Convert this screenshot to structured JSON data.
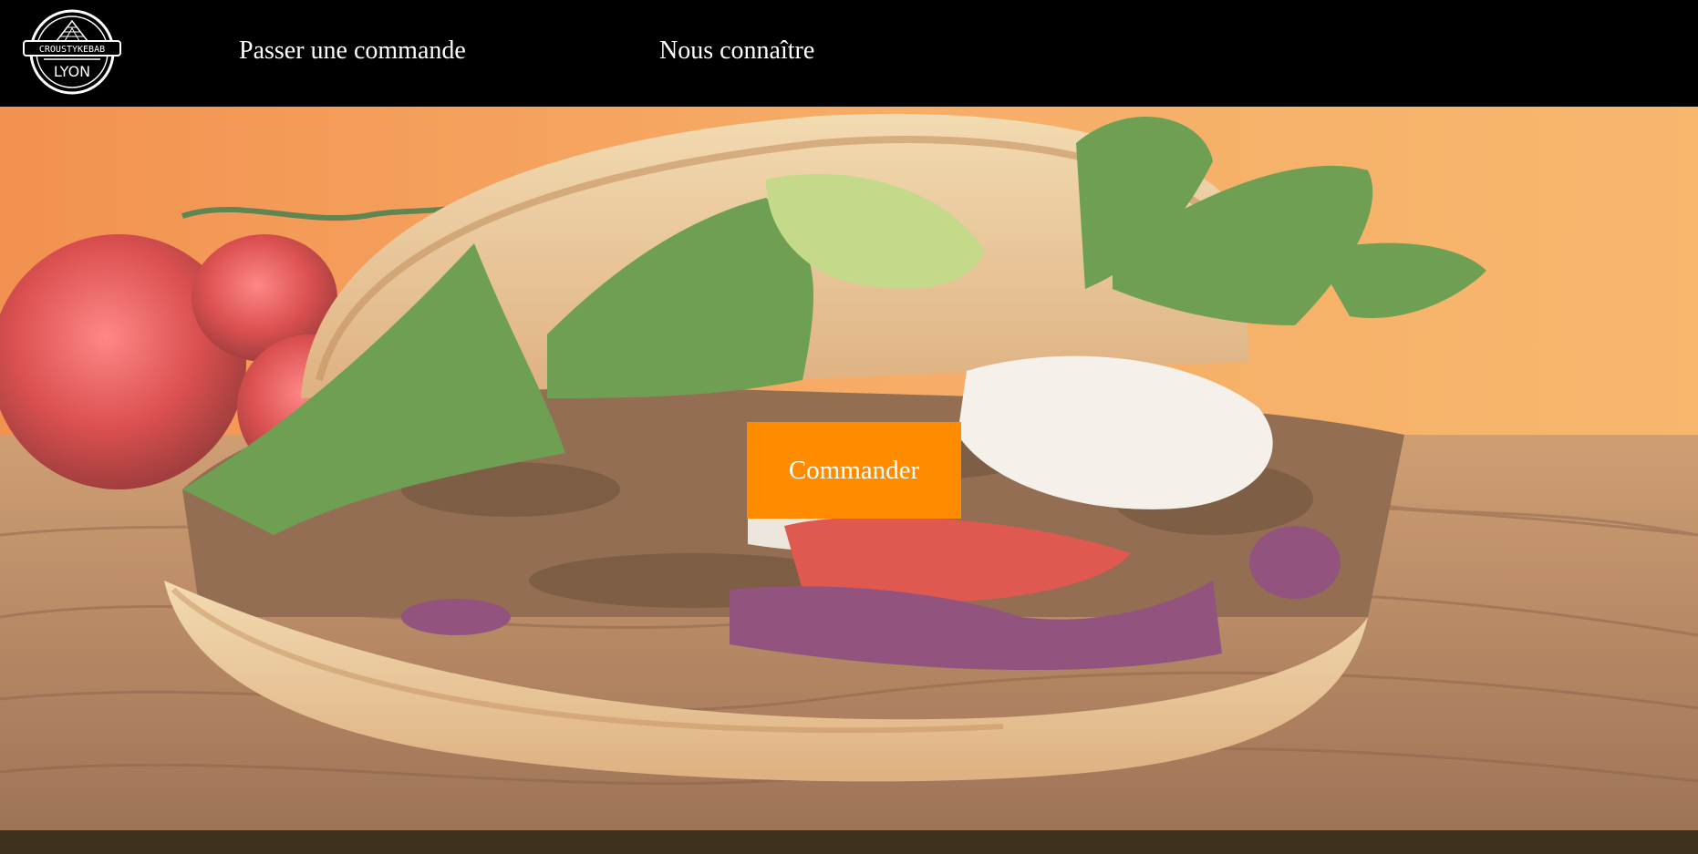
{
  "brand": {
    "logo_name": "CROUSTYKEBAB",
    "logo_city": "LYON"
  },
  "nav": {
    "items": [
      {
        "label": "Passer une commande"
      },
      {
        "label": "Nous connaître"
      }
    ]
  },
  "hero": {
    "image_subject": "kebab sandwich on wooden table",
    "cta_label": "Commander"
  },
  "colors": {
    "navbar": "#000000",
    "cta": "#ff8c00",
    "footer": "#3d301d"
  }
}
